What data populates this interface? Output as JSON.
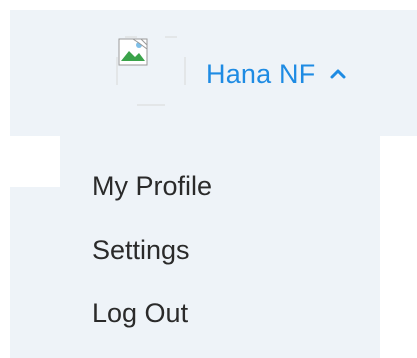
{
  "header": {
    "user_name": "Hana NF",
    "avatar_icon": "broken-image-icon",
    "chevron_icon": "chevron-up-icon",
    "accent_color": "#1e8be3",
    "background_color": "#eef3f8"
  },
  "menu": {
    "items": [
      {
        "label": "My Profile"
      },
      {
        "label": "Settings"
      },
      {
        "label": "Log Out"
      }
    ]
  }
}
